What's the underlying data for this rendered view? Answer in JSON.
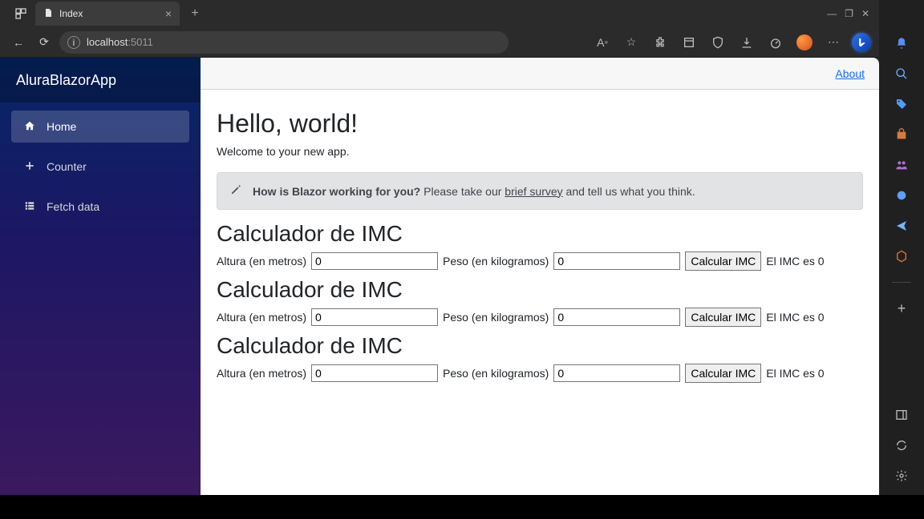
{
  "browser": {
    "tab_title": "Index",
    "url_host": "localhost",
    "url_port": ":5011",
    "win": {
      "min": "—",
      "max": "❐",
      "close": "✕"
    }
  },
  "app": {
    "brand": "AluraBlazorApp",
    "about": "About",
    "nav": [
      {
        "icon": "home",
        "label": "Home",
        "active": true
      },
      {
        "icon": "plus",
        "label": "Counter",
        "active": false
      },
      {
        "icon": "list",
        "label": "Fetch data",
        "active": false
      }
    ]
  },
  "page": {
    "h1": "Hello, world!",
    "welcome": "Welcome to your new app.",
    "alert": {
      "strong": "How is Blazor working for you?",
      "pre": " Please take our ",
      "link": "brief survey",
      "post": " and tell us what you think."
    },
    "calc_title": "Calculador de IMC",
    "labels": {
      "altura": "Altura (en metros)",
      "peso": "Peso (en kilogramos)",
      "btn": "Calcular IMC",
      "result": "El IMC es 0"
    },
    "calcs": [
      {
        "altura": "0",
        "peso": "0"
      },
      {
        "altura": "0",
        "peso": "0"
      },
      {
        "altura": "0",
        "peso": "0"
      }
    ]
  },
  "sidebar_colors": {
    "bell": "#5a8dee",
    "search": "#6aa9ff",
    "tag": "#4f9cff",
    "bag": "#d67a3c",
    "people": "#b06fd6",
    "circle": "#5aa0ff",
    "send": "#6fb8ff",
    "hex": "#e06a3c"
  }
}
